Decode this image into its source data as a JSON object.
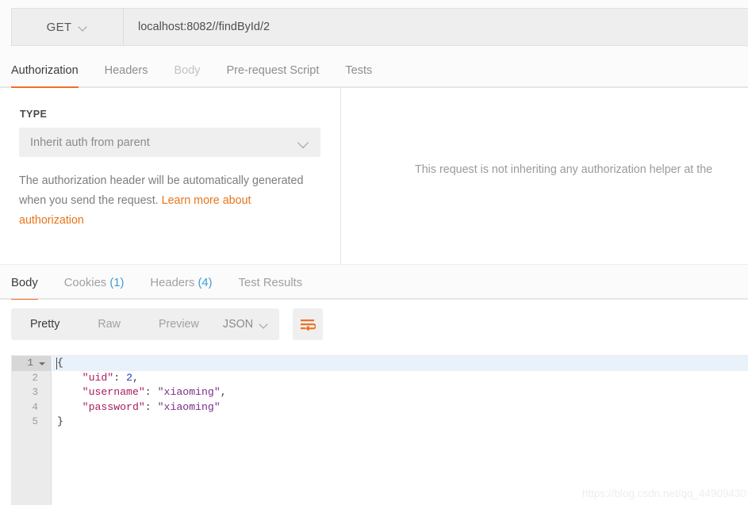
{
  "request": {
    "method": "GET",
    "method_chevron_icon": "chevron-down-icon",
    "url": "localhost:8082//findById/2",
    "url_placeholder": "Enter request URL",
    "tabs": [
      {
        "label": "Authorization",
        "active": true,
        "state": "normal"
      },
      {
        "label": "Headers",
        "active": false,
        "state": "semi"
      },
      {
        "label": "Body",
        "active": false,
        "state": "muted"
      },
      {
        "label": "Pre-request Script",
        "active": false,
        "state": "semi"
      },
      {
        "label": "Tests",
        "active": false,
        "state": "semi"
      }
    ]
  },
  "authorization": {
    "type_label": "TYPE",
    "selected_type": "Inherit auth from parent",
    "type_chevron_icon": "chevron-down-icon",
    "help_text": "The authorization header will be automatically generated when you send the request. ",
    "help_link": "Learn more about authorization",
    "right_notice": "This request is not inheriting any authorization helper at the"
  },
  "response": {
    "tabs": [
      {
        "label": "Body",
        "count": "",
        "active": true
      },
      {
        "label": "Cookies",
        "count": "(1)",
        "active": false
      },
      {
        "label": "Headers",
        "count": "(4)",
        "active": false
      },
      {
        "label": "Test Results",
        "count": "",
        "active": false
      }
    ],
    "view_modes": [
      {
        "label": "Pretty",
        "active": true
      },
      {
        "label": "Raw",
        "active": false
      },
      {
        "label": "Preview",
        "active": false
      }
    ],
    "format": "JSON",
    "format_chevron_icon": "chevron-down-icon",
    "wrap_icon": "word-wrap-icon",
    "body_lines": [
      {
        "num": "1",
        "folded": true,
        "tokens": [
          {
            "t": "{",
            "c": "p"
          }
        ]
      },
      {
        "num": "2",
        "folded": false,
        "tokens": [
          {
            "t": "    \"uid\"",
            "c": "k"
          },
          {
            "t": ": ",
            "c": "p"
          },
          {
            "t": "2",
            "c": "n"
          },
          {
            "t": ",",
            "c": "p"
          }
        ]
      },
      {
        "num": "3",
        "folded": false,
        "tokens": [
          {
            "t": "    \"username\"",
            "c": "k"
          },
          {
            "t": ": ",
            "c": "p"
          },
          {
            "t": "\"xiaoming\"",
            "c": "s"
          },
          {
            "t": ",",
            "c": "p"
          }
        ]
      },
      {
        "num": "4",
        "folded": false,
        "tokens": [
          {
            "t": "    \"password\"",
            "c": "k"
          },
          {
            "t": ": ",
            "c": "p"
          },
          {
            "t": "\"xiaoming\"",
            "c": "s"
          }
        ]
      },
      {
        "num": "5",
        "folded": false,
        "tokens": [
          {
            "t": "}",
            "c": "p"
          }
        ]
      }
    ]
  },
  "watermark": "https://blog.csdn.net/qq_44909430",
  "colors": {
    "accent_orange": "#ef7024",
    "link_orange": "#e8751a",
    "count_blue": "#3f9bd9",
    "highlight_blue": "#e9f1fb",
    "json_key": "#a71d5d",
    "json_string": "#7b2d8b",
    "json_number": "#1f3fa8"
  }
}
